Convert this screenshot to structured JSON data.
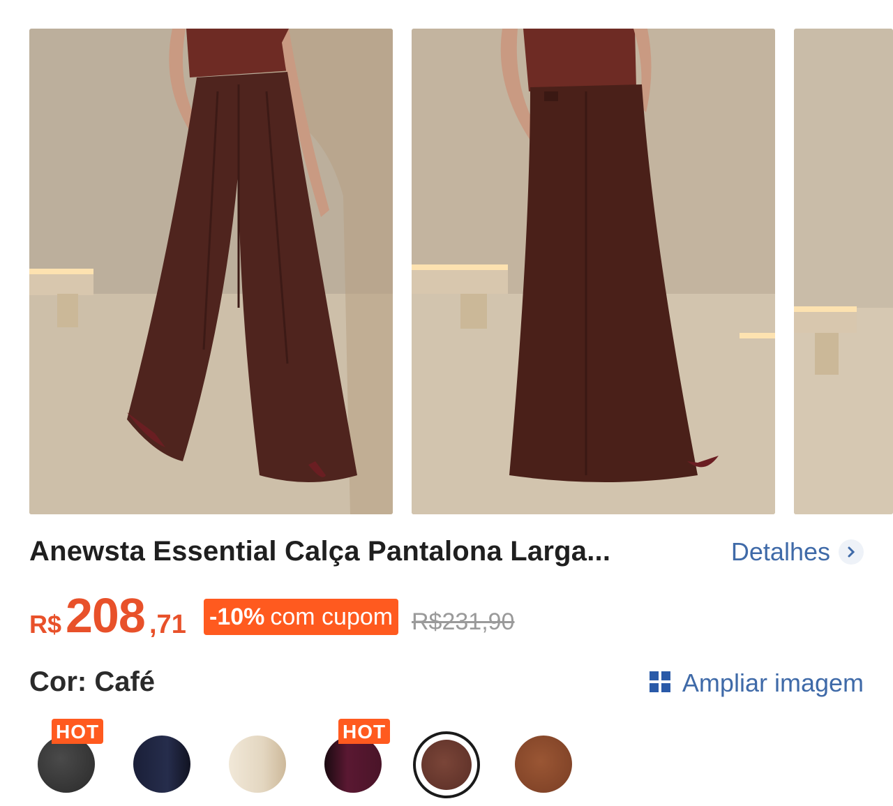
{
  "product": {
    "title": "Anewsta Essential Calça Pantalona Larga...",
    "details_label": "Detalhes"
  },
  "price": {
    "currency": "R$",
    "integer": "208",
    "cents": ",71",
    "coupon_bold": "-10%",
    "coupon_text": "com cupom",
    "original": "R$231,90"
  },
  "color": {
    "label": "Cor: Café",
    "zoom_label": "Ampliar imagem"
  },
  "swatches": [
    {
      "name": "preto",
      "color": "#3a3a3a",
      "hot": "HOT"
    },
    {
      "name": "marinho",
      "color": "#1e2440",
      "hot": ""
    },
    {
      "name": "bege",
      "color": "#e8ddca",
      "hot": ""
    },
    {
      "name": "vinho",
      "color": "#4a1428",
      "hot": "HOT"
    },
    {
      "name": "cafe",
      "color": "#6b3a30",
      "hot": "",
      "selected": true
    },
    {
      "name": "caramelo",
      "color": "#8a4a2c",
      "hot": ""
    }
  ],
  "colors": {
    "accent": "#ff5a1f",
    "price": "#e8512a",
    "link": "#3f6aa8"
  }
}
